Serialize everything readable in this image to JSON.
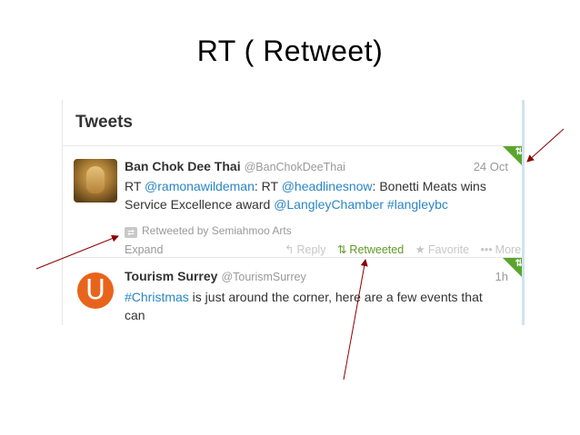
{
  "slide": {
    "title": "RT ( Retweet)"
  },
  "panel": {
    "heading": "Tweets"
  },
  "tweets": [
    {
      "name": "Ban Chok Dee Thai",
      "handle": "@BanChokDeeThai",
      "time": "24 Oct",
      "text": {
        "rt_prefix": "RT",
        "mention1": "@ramonawildeman",
        "mid1": ": RT",
        "mention2": "@headlinesnow",
        "mid2": ": Bonetti Meats wins Service Excellence award",
        "mention3": "@LangleyChamber",
        "hashtag": "#langleybc"
      },
      "retweeted_by": "Retweeted by Semiahmoo Arts",
      "expand": "Expand",
      "actions": {
        "reply": "Reply",
        "retweeted": "Retweeted",
        "favorite": "Favorite",
        "more": "More"
      }
    },
    {
      "name": "Tourism Surrey",
      "handle": "@TourismSurrey",
      "time": "1h",
      "text": {
        "hashtag": "#Christmas",
        "rest": " is just around the corner, here are a few events that can"
      }
    }
  ],
  "icons": {
    "reply": "reply-icon",
    "retweet": "retweet-icon",
    "favorite": "star-icon",
    "more": "more-dots-icon",
    "avatar2_letter": "U"
  },
  "colors": {
    "link": "#2a86c5",
    "retweet_green": "#609928",
    "corner_green": "#5aa62c",
    "arrow": "#8b0000"
  }
}
